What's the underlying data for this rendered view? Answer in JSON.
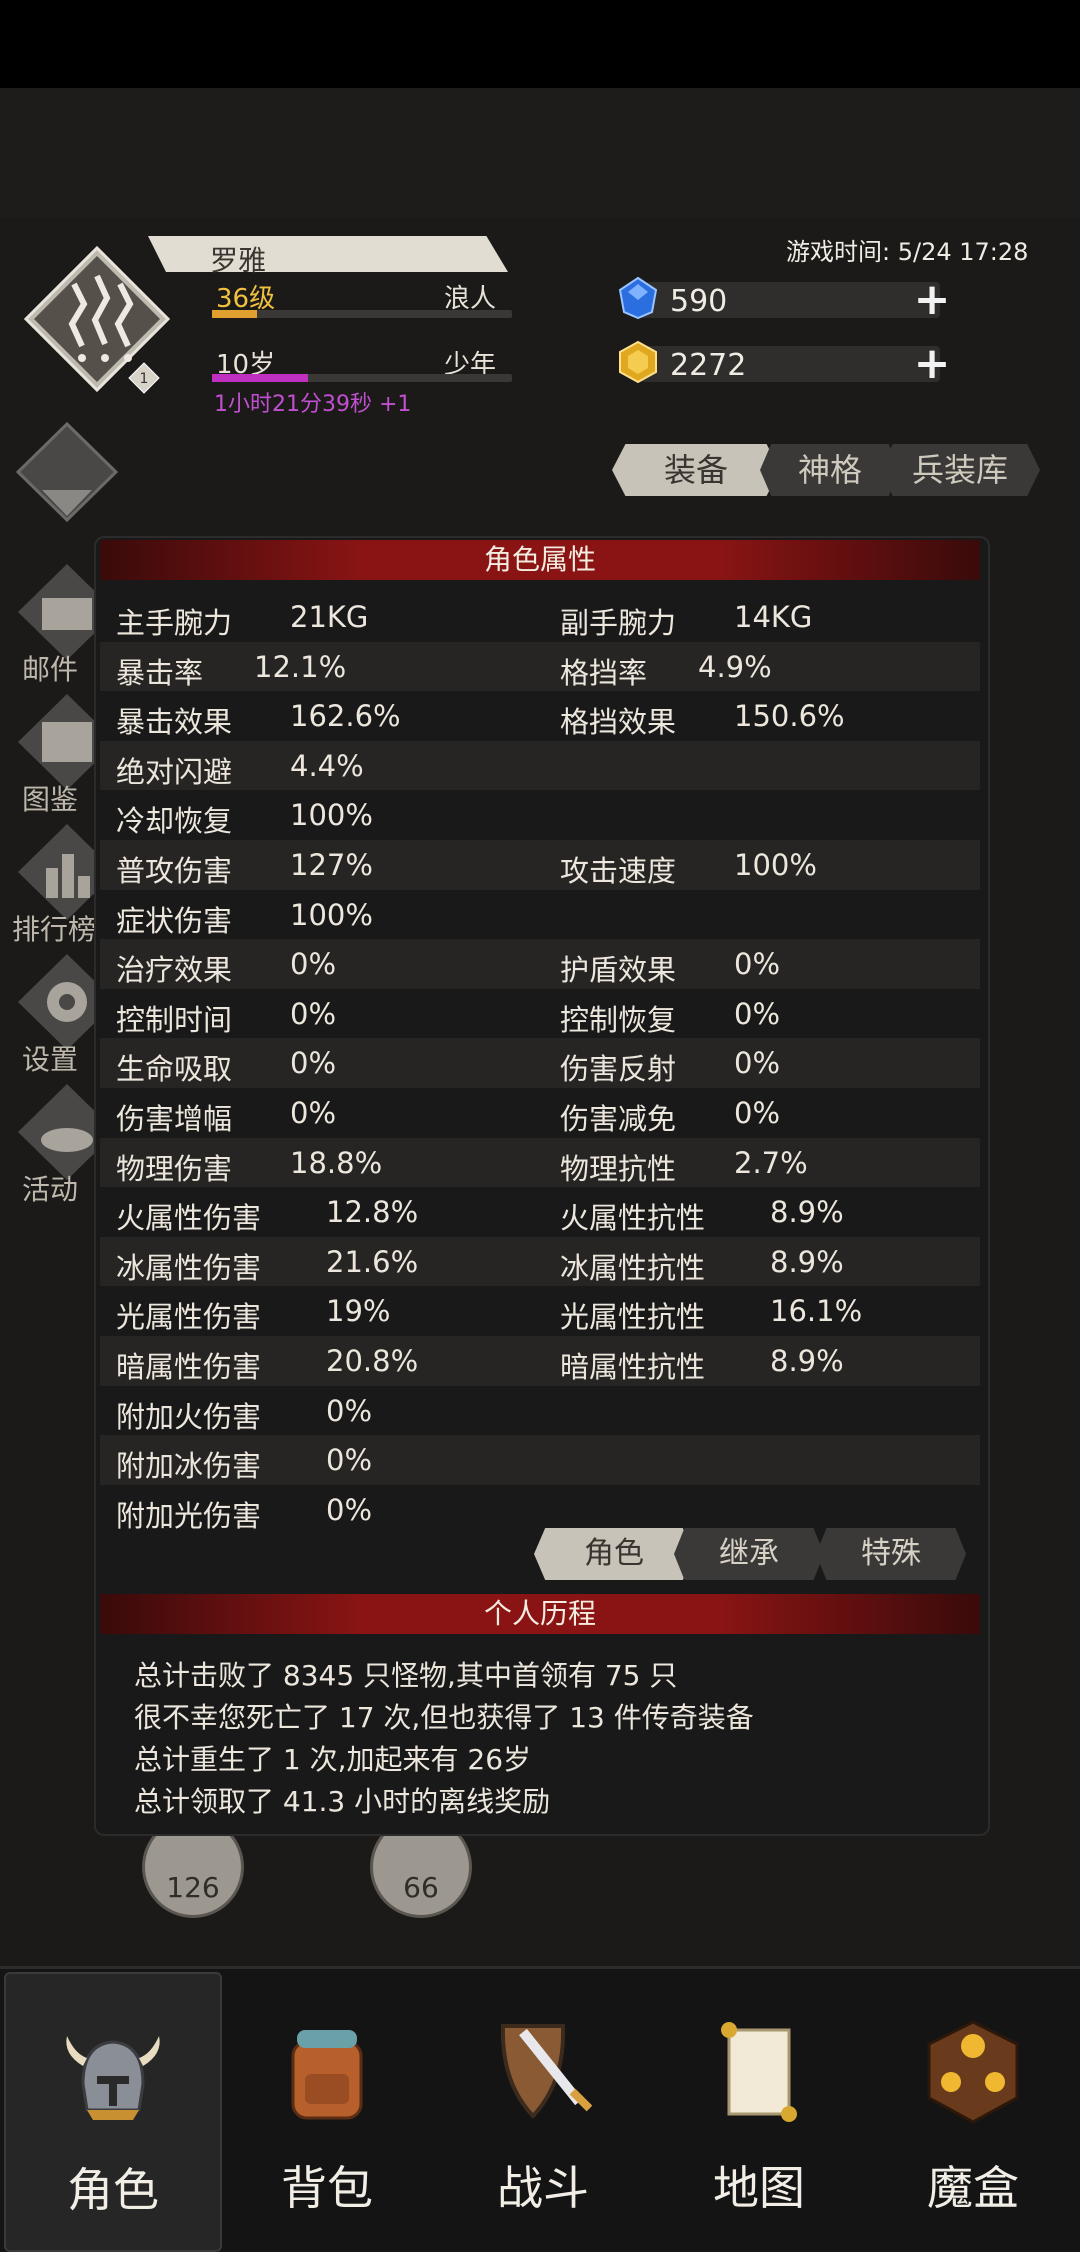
{
  "header": {
    "character_name": "罗雅",
    "level": "36级",
    "class": "浪人",
    "age": "10岁",
    "life_stage": "少年",
    "age_timer": "1小时21分39秒 +1",
    "level_badge": "1",
    "game_time": "游戏时间: 5/24 17:28",
    "gems": "590",
    "gold": "2272",
    "xp_progress": 0.15,
    "age_progress": 0.32
  },
  "top_tabs": [
    "装备",
    "神格",
    "兵装库"
  ],
  "side_menu": [
    "邮件",
    "图鉴",
    "排行榜",
    "设置",
    "活动"
  ],
  "attributes_panel": {
    "title": "角色属性",
    "rows": [
      {
        "l1": "主手腕力",
        "v1": "21KG",
        "l2": "副手腕力",
        "v2": "14KG"
      },
      {
        "l1": "暴击率",
        "v1": "12.1%",
        "l2": "格挡率",
        "v2": "4.9%"
      },
      {
        "l1": "暴击效果",
        "v1": "162.6%",
        "l2": "格挡效果",
        "v2": "150.6%"
      },
      {
        "l1": "绝对闪避",
        "v1": "4.4%",
        "l2": "",
        "v2": ""
      },
      {
        "l1": "冷却恢复",
        "v1": "100%",
        "l2": "",
        "v2": ""
      },
      {
        "l1": "普攻伤害",
        "v1": "127%",
        "l2": "攻击速度",
        "v2": "100%"
      },
      {
        "l1": "症状伤害",
        "v1": "100%",
        "l2": "",
        "v2": ""
      },
      {
        "l1": "治疗效果",
        "v1": "0%",
        "l2": "护盾效果",
        "v2": "0%"
      },
      {
        "l1": "控制时间",
        "v1": "0%",
        "l2": "控制恢复",
        "v2": "0%"
      },
      {
        "l1": "生命吸取",
        "v1": "0%",
        "l2": "伤害反射",
        "v2": "0%"
      },
      {
        "l1": "伤害增幅",
        "v1": "0%",
        "l2": "伤害减免",
        "v2": "0%"
      },
      {
        "l1": "物理伤害",
        "v1": "18.8%",
        "l2": "物理抗性",
        "v2": "2.7%"
      },
      {
        "l1": "火属性伤害",
        "v1": "12.8%",
        "l2": "火属性抗性",
        "v2": "8.9%"
      },
      {
        "l1": "冰属性伤害",
        "v1": "21.6%",
        "l2": "冰属性抗性",
        "v2": "8.9%"
      },
      {
        "l1": "光属性伤害",
        "v1": "19%",
        "l2": "光属性抗性",
        "v2": "16.1%"
      },
      {
        "l1": "暗属性伤害",
        "v1": "20.8%",
        "l2": "暗属性抗性",
        "v2": "8.9%"
      },
      {
        "l1": "附加火伤害",
        "v1": "0%",
        "l2": "",
        "v2": ""
      },
      {
        "l1": "附加冰伤害",
        "v1": "0%",
        "l2": "",
        "v2": ""
      },
      {
        "l1": "附加光伤害",
        "v1": "0%",
        "l2": "",
        "v2": ""
      }
    ],
    "sub_tabs": [
      "角色",
      "继承",
      "特殊"
    ]
  },
  "history_panel": {
    "title": "个人历程",
    "lines": [
      "总计击败了 8345 只怪物,其中首领有 75 只",
      "很不幸您死亡了 17 次,但也获得了 13 件传奇装备",
      "总计重生了 1 次,加起来有 26岁",
      "总计领取了 41.3 小时的离线奖励"
    ]
  },
  "background_dials": [
    "126",
    "66"
  ],
  "bottom_nav": [
    "角色",
    "背包",
    "战斗",
    "地图",
    "魔盒"
  ],
  "colors": {
    "accent_red": "#8a1414",
    "level_gold": "#f0c040",
    "timer_purple": "#c050d0"
  }
}
